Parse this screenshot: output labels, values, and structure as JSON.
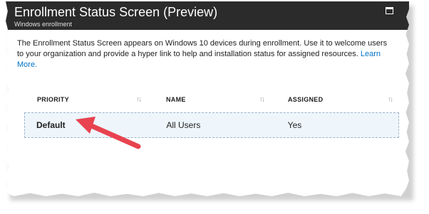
{
  "header": {
    "title": "Enrollment Status Screen (Preview)",
    "subtitle": "Windows enrollment",
    "maximize_icon": "maximize-icon"
  },
  "description": {
    "text": "The Enrollment Status Screen appears on Windows 10 devices during enrollment. Use it to welcome users to your organization and provide a hyper link to help and installation status for assigned resources.",
    "link_label": "Learn More."
  },
  "grid": {
    "columns": [
      {
        "label": "PRIORITY",
        "sort_icon": "sort-arrows-icon"
      },
      {
        "label": "NAME",
        "sort_icon": "sort-arrows-icon"
      },
      {
        "label": "ASSIGNED",
        "sort_icon": "sort-arrows-icon"
      }
    ],
    "rows": [
      {
        "priority": "Default",
        "name": "All Users",
        "assigned": "Yes"
      }
    ]
  },
  "annotation": {
    "arrow_color": "#e8434f"
  },
  "colors": {
    "header_bg": "#2b2b2b",
    "link": "#0072c6",
    "row_highlight": "#eef6fc"
  }
}
